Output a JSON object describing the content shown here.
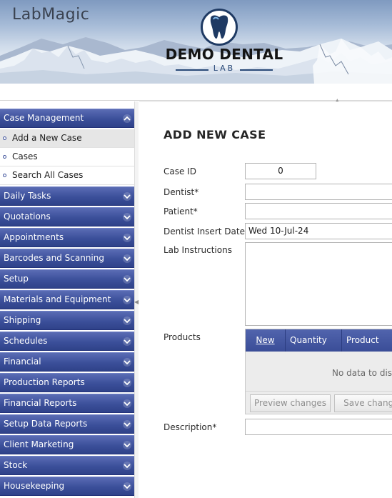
{
  "app": {
    "name": "LabMagic"
  },
  "brand": {
    "title": "DEMO DENTAL",
    "subtitle": "LAB"
  },
  "sidebar": {
    "groups": [
      {
        "label": "Case Management",
        "expanded": true,
        "items": [
          {
            "label": "Add a New Case",
            "active": true
          },
          {
            "label": "Cases",
            "active": false
          },
          {
            "label": "Search All Cases",
            "active": false
          }
        ]
      },
      {
        "label": "Daily Tasks"
      },
      {
        "label": "Quotations"
      },
      {
        "label": "Appointments"
      },
      {
        "label": "Barcodes and Scanning"
      },
      {
        "label": "Setup"
      },
      {
        "label": "Materials and Equipment"
      },
      {
        "label": "Shipping"
      },
      {
        "label": "Schedules"
      },
      {
        "label": "Financial"
      },
      {
        "label": "Production Reports"
      },
      {
        "label": "Financial Reports"
      },
      {
        "label": "Setup Data Reports"
      },
      {
        "label": "Client Marketing"
      },
      {
        "label": "Stock"
      },
      {
        "label": "Housekeeping"
      }
    ]
  },
  "form": {
    "title": "ADD NEW CASE",
    "case_id": {
      "label": "Case ID",
      "value": "0"
    },
    "dentist": {
      "label": "Dentist*",
      "value": ""
    },
    "patient": {
      "label": "Patient*",
      "value": ""
    },
    "insert_date": {
      "label": "Dentist Insert Date*",
      "value": "Wed 10-Jul-24"
    },
    "lab_instructions": {
      "label": "Lab Instructions",
      "value": ""
    },
    "products": {
      "label": "Products",
      "columns": [
        "New",
        "Quantity",
        "Product"
      ],
      "empty_text": "No data to displ",
      "preview_button": "Preview changes",
      "save_button": "Save changes"
    },
    "description": {
      "label": "Description*",
      "value": ""
    }
  },
  "colors": {
    "nav": "#3b4f9a",
    "accent": "#1f3a63"
  }
}
